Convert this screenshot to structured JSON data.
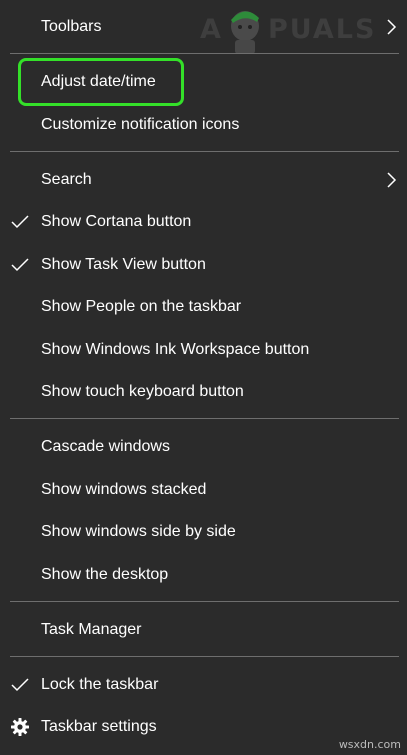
{
  "menu": {
    "items": {
      "toolbars": "Toolbars",
      "adjust_datetime": "Adjust date/time",
      "customize_notification_icons": "Customize notification icons",
      "search": "Search",
      "show_cortana_button": "Show Cortana button",
      "show_task_view_button": "Show Task View button",
      "show_people": "Show People on the taskbar",
      "show_ink_workspace": "Show Windows Ink Workspace button",
      "show_touch_keyboard": "Show touch keyboard button",
      "cascade_windows": "Cascade windows",
      "show_windows_stacked": "Show windows stacked",
      "show_windows_side_by_side": "Show windows side by side",
      "show_desktop": "Show the desktop",
      "task_manager": "Task Manager",
      "lock_taskbar": "Lock the taskbar",
      "taskbar_settings": "Taskbar settings"
    },
    "checked": [
      "show_cortana_button",
      "show_task_view_button",
      "lock_taskbar"
    ],
    "submenu_items": [
      "toolbars",
      "search"
    ]
  },
  "watermark": {
    "logo_text": "APPUALS",
    "footer_text": "wsxdn.com"
  },
  "colors": {
    "menu_background": "#2b2b2b",
    "text": "#ffffff",
    "separator": "#6e6e6e",
    "highlight_outline": "#34e029"
  },
  "icons": {
    "check": "checkmark-icon",
    "submenu": "chevron-right-icon",
    "settings": "gear-icon"
  }
}
